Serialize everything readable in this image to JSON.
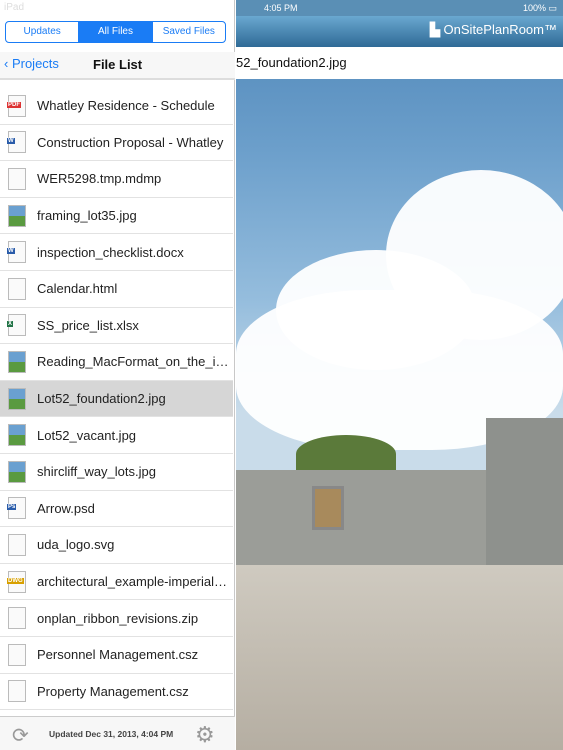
{
  "status_left": {
    "device": "iPad"
  },
  "status_right": {
    "time": "4:05 PM",
    "battery": "100%"
  },
  "tabs": [
    {
      "label": "Updates",
      "active": false
    },
    {
      "label": "All Files",
      "active": true
    },
    {
      "label": "Saved Files",
      "active": false
    }
  ],
  "nav": {
    "back": "Projects",
    "title": "File List"
  },
  "files": [
    {
      "name": "Whatley Residence - Schedule",
      "type": "pdf"
    },
    {
      "name": "Construction Proposal - Whatley",
      "type": "doc"
    },
    {
      "name": "WER5298.tmp.mdmp",
      "type": "file"
    },
    {
      "name": "framing_lot35.jpg",
      "type": "img"
    },
    {
      "name": "inspection_checklist.docx",
      "type": "doc"
    },
    {
      "name": "Calendar.html",
      "type": "file"
    },
    {
      "name": "SS_price_list.xlsx",
      "type": "xls"
    },
    {
      "name": "Reading_MacFormat_on_the_iPad.jpg",
      "type": "img"
    },
    {
      "name": "Lot52_foundation2.jpg",
      "type": "img",
      "selected": true
    },
    {
      "name": "Lot52_vacant.jpg",
      "type": "img"
    },
    {
      "name": "shircliff_way_lots.jpg",
      "type": "img"
    },
    {
      "name": "Arrow.psd",
      "type": "psd"
    },
    {
      "name": "uda_logo.svg",
      "type": "file"
    },
    {
      "name": "architectural_example-imperial.dwg",
      "type": "dwg"
    },
    {
      "name": "onplan_ribbon_revisions.zip",
      "type": "zip"
    },
    {
      "name": "Personnel Management.csz",
      "type": "csz"
    },
    {
      "name": "Property Management.csz",
      "type": "csz"
    }
  ],
  "footer": {
    "updated": "Updated Dec 31, 2013, 4:04 PM"
  },
  "viewer": {
    "logo": "OnSitePlanRoom™",
    "filename": "52_foundation2.jpg"
  },
  "colors": {
    "accent": "#1a7cf5",
    "selected": "#d6d6d6"
  }
}
